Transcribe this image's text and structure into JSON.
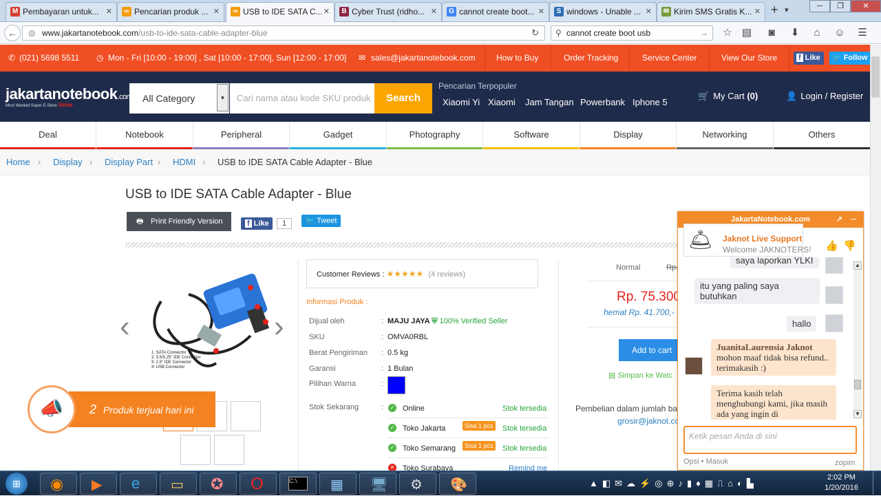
{
  "browser": {
    "tabs": [
      {
        "label": "Pembayaran untuk...",
        "fav": "M",
        "color": "#d23f31"
      },
      {
        "label": "Pencarian produk ...",
        "fav": "∞",
        "color": "#f39c12"
      },
      {
        "label": "USB to IDE SATA C...",
        "fav": "∞",
        "color": "#f39c12"
      },
      {
        "label": "Cyber Trust (ridho...",
        "fav": "B",
        "color": "#8e2442"
      },
      {
        "label": "cannot create boot...",
        "fav": "G",
        "color": "#4285f4"
      },
      {
        "label": "windows - Unable ...",
        "fav": "S",
        "color": "#2f6fb5"
      },
      {
        "label": "Kirim SMS Gratis K...",
        "fav": "✉",
        "color": "#7a9a3c"
      }
    ],
    "new_tab": "+",
    "url_domain": "www.jakartanotebook.com",
    "url_path": "/usb-to-ide-sata-cable-adapter-blue",
    "search_value": "cannot create boot usb"
  },
  "topbar": {
    "phone": "(021) 5698 5511",
    "hours": "Mon - Fri [10:00 - 19:00] ,  Sat [10:00 - 17:00],  Sun [12:00 - 17:00]",
    "email": "sales@jakartanotebook.com",
    "links": [
      "How to Buy",
      "Order Tracking",
      "Service Center",
      "View Our Store"
    ],
    "fb_like": "Like",
    "tw_follow": "Follow"
  },
  "header": {
    "logo": "jakartanotebook",
    "logo_suffix": ".com",
    "logo_tagline": "Most Wanted Super E-Store",
    "logo_badge": "Value",
    "category": "All Category",
    "search_placeholder": "Cari nama atau kode SKU produk",
    "search_button": "Search",
    "popular_label": "Pencarian Terpopuler",
    "popular": [
      "Xiaomi Yi",
      "Xiaomi",
      "Jam Tangan",
      "Powerbank",
      "Iphone 5"
    ],
    "cart": "My Cart",
    "cart_count": "(0)",
    "login": "Login / Register"
  },
  "categories": [
    {
      "label": "Deal",
      "color": "#e5231b"
    },
    {
      "label": "Notebook",
      "color": "#e5231b"
    },
    {
      "label": "Peripheral",
      "color": "#8e7cc3"
    },
    {
      "label": "Gadget",
      "color": "#27b1de"
    },
    {
      "label": "Photography",
      "color": "#7dbb42"
    },
    {
      "label": "Software",
      "color": "#f4c20d"
    },
    {
      "label": "Display",
      "color": "#f58220"
    },
    {
      "label": "Networking",
      "color": "#666666"
    },
    {
      "label": "Others",
      "color": "#333333"
    }
  ],
  "breadcrumb": [
    "Home",
    "Display",
    "Display Part",
    "HDMI"
  ],
  "breadcrumb_current": "USB to IDE SATA Cable Adapter - Blue",
  "product": {
    "title": "USB to IDE SATA Cable Adapter - Blue",
    "print": "Print Friendly Version",
    "like": "Like",
    "like_count": "1",
    "tweet": "Tweet",
    "reviews_label": "Customer Reviews :",
    "reviews_count": "(4 reviews)",
    "info_title": "Informasi Produk :",
    "seller_label": "Dijual oleh",
    "seller": "MAJU JAYA",
    "verified": "100% Verified Seller",
    "sku_label": "SKU",
    "sku": "OMVA0RBL",
    "weight_label": "Berat Pengiriman",
    "weight": "0.5 kg",
    "warranty_label": "Garansi",
    "warranty": "1 Bulan",
    "color_label": "Pilihan Warna",
    "swatch": "#0000ff",
    "stock_label": "Stok Sekarang",
    "stock": [
      {
        "loc": "Online",
        "sisa": "",
        "status": "Stok tersedia"
      },
      {
        "loc": "Toko Jakarta",
        "sisa": "Sisa 1 pcs",
        "status": "Stok tersedia"
      },
      {
        "loc": "Toko Semarang",
        "sisa": "Sisa 1 pcs",
        "status": "Stok tersedia"
      },
      {
        "loc": "Toko Surabaya",
        "sisa": "",
        "status": "Remind me"
      }
    ],
    "img_labels": [
      "1: SATA Connector",
      "2: 3.5/5.25\" IDE Connector",
      "3: 2.5\" IDE Connector",
      "4: USB Connector"
    ],
    "sold_count": "2",
    "sold_text": "Produk terjual hari ini",
    "price_normal_label": "Normal",
    "price_strike": "Rp.",
    "price": "Rp. 75.300",
    "save": "hemat Rp. 41.700,-",
    "add_to_cart": "Add to cart",
    "wishlist": "Simpan ke Watc",
    "bulk": "Pembelian dalam jumlah ba",
    "bulk_email": "grosir@jaknot.co"
  },
  "chat": {
    "header": "JakartaNotebook.com",
    "agent": "Jaknot Live Support",
    "welcome": "Welcome JAKNOTERS!",
    "msgs": [
      "saya laporkan YLKI",
      "itu yang paling saya butuhkan",
      "hallo"
    ],
    "agent_name": "JuanitaLaurensia Jaknot",
    "agent_msg": "mohon maaf tidak bisa refund.. terimakasih :)",
    "agent_msg2": "Terima kasih telah menghubungi kami, jika masih ada yang ingin di",
    "input_placeholder": "Ketik pesan Anda di sini",
    "footer_left": "Opsi • Masuk",
    "footer_right": "zopim"
  },
  "taskbar": {
    "time": "2:02 PM",
    "date": "1/20/2016"
  }
}
